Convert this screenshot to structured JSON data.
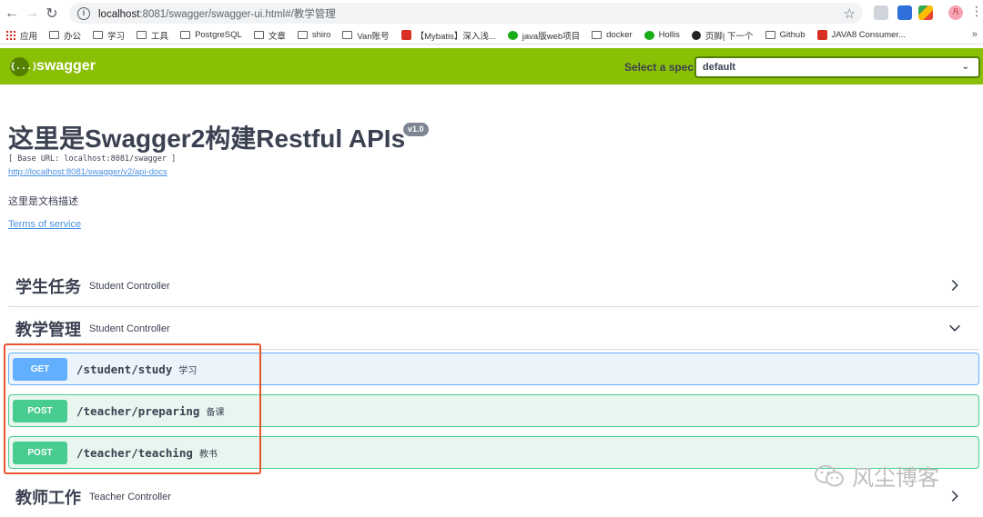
{
  "browser": {
    "url_host": "localhost",
    "url_rest": ":8081/swagger/swagger-ui.html#/教学管理",
    "bookmarks": [
      "应用",
      "办公",
      "学习",
      "工具",
      "PostgreSQL",
      "文章",
      "shiro",
      "Van账号",
      "【Mybatis】深入浅...",
      "java版web项目",
      "docker",
      "Hollis",
      "页脚| 下一个",
      "Github",
      "JAVA8 Consumer..."
    ],
    "bookmarks_more": "»",
    "avatar_text": "凡"
  },
  "topbar": {
    "logo_mark": "{...}",
    "logo_text": "swagger",
    "spec_label": "Select a spec",
    "spec_value": "default"
  },
  "info": {
    "title": "这里是Swagger2构建Restful APIs",
    "version": "v1.0",
    "base_url": "[ Base URL: localhost:8081/swagger ]",
    "api_docs_link": "http://localhost:8081/swagger/v2/api-docs",
    "description": "这里是文档描述",
    "terms_link": "Terms of service"
  },
  "tags": [
    {
      "name": "学生任务",
      "description": "Student Controller",
      "expanded": false
    },
    {
      "name": "教学管理",
      "description": "Student Controller",
      "expanded": true
    },
    {
      "name": "教师工作",
      "description": "Teacher Controller",
      "expanded": false
    }
  ],
  "operations": [
    {
      "method": "GET",
      "path": "/student/study",
      "summary": "学习"
    },
    {
      "method": "POST",
      "path": "/teacher/preparing",
      "summary": "备课"
    },
    {
      "method": "POST",
      "path": "/teacher/teaching",
      "summary": "教书"
    }
  ],
  "watermark": "风尘博客",
  "colors": {
    "topbar": "#89bf04",
    "get": "#61affe",
    "post": "#49cc90",
    "highlight": "#e8542e"
  }
}
